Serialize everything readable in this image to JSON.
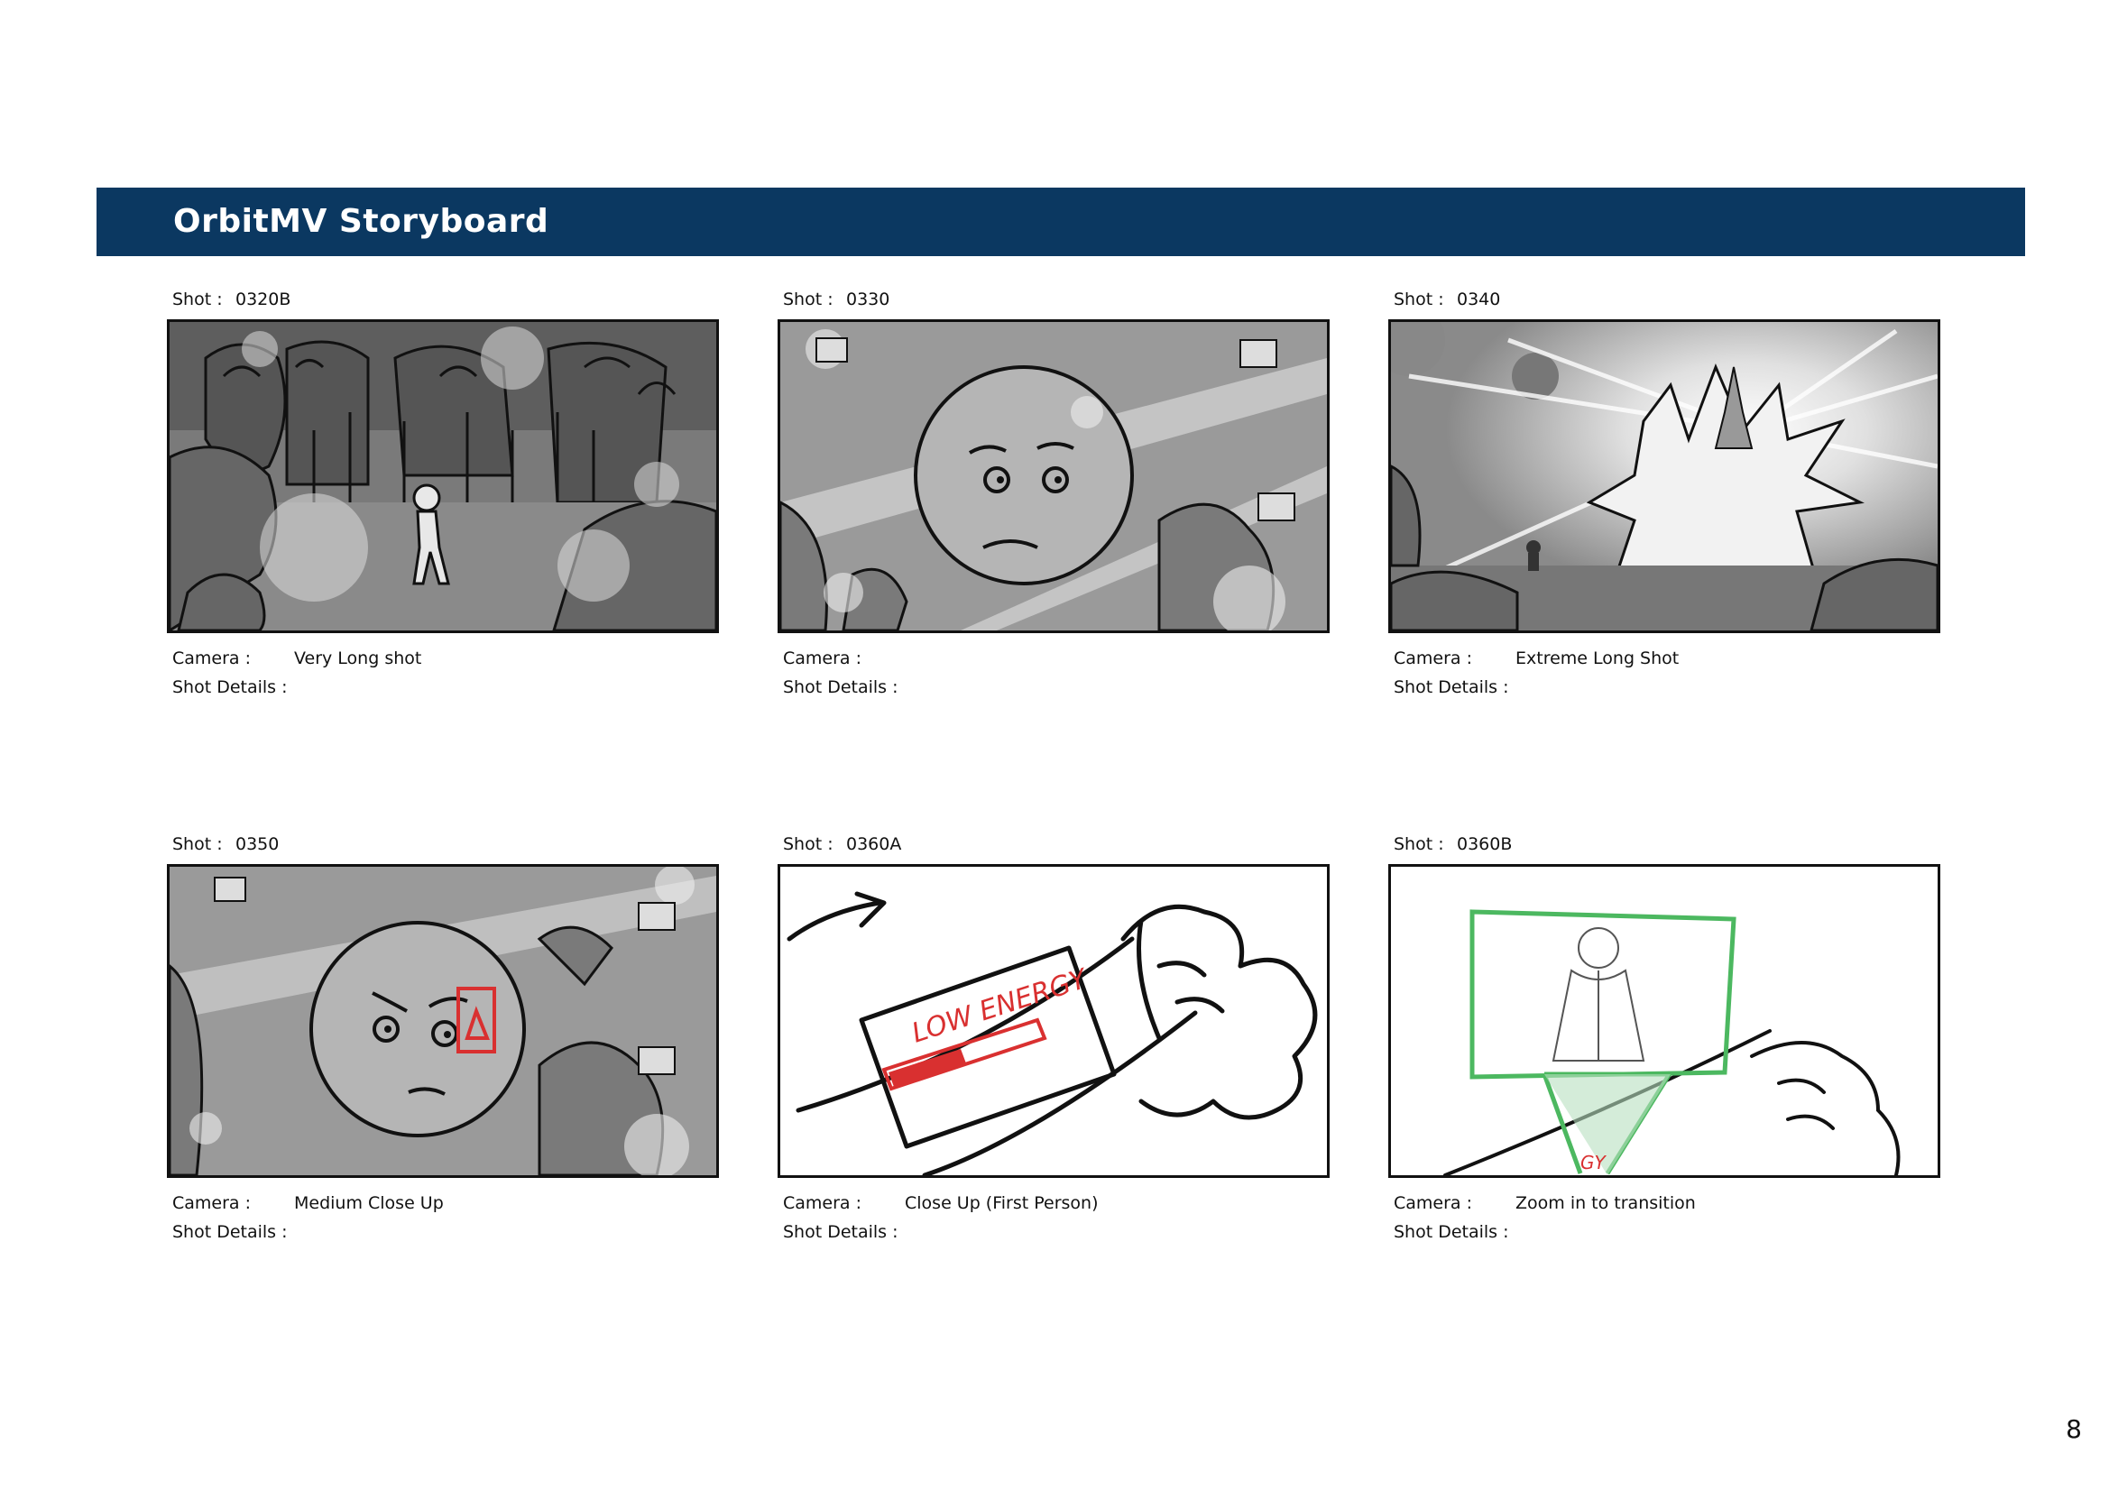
{
  "header": {
    "title": "OrbitMV Storyboard"
  },
  "labels": {
    "shot": "Shot :",
    "camera": "Camera :",
    "details": "Shot Details :"
  },
  "panels": [
    {
      "shot": "0320B",
      "camera": "Very Long shot",
      "details": ""
    },
    {
      "shot": "0330",
      "camera": "",
      "details": ""
    },
    {
      "shot": "0340",
      "camera": "Extreme Long Shot",
      "details": ""
    },
    {
      "shot": "0350",
      "camera": "Medium Close Up",
      "details": ""
    },
    {
      "shot": "0360A",
      "camera": "Close Up (First Person)",
      "details": ""
    },
    {
      "shot": "0360B",
      "camera": "Zoom in to transition",
      "details": ""
    }
  ],
  "sketch_text": {
    "low_energy": "LOW ENERGY",
    "energy_partial": "GY"
  },
  "colors": {
    "header": "#0b3861",
    "warning_red": "#d93030",
    "hologram_green": "#4cb860"
  },
  "page_number": "8"
}
